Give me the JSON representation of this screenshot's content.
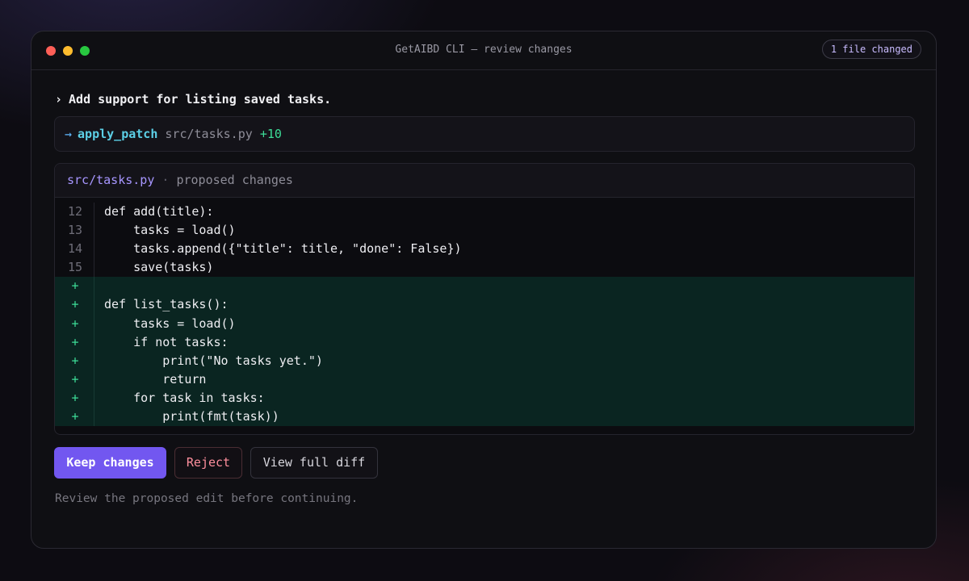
{
  "window": {
    "title": "GetAIBD CLI — review changes",
    "badge": "1 file changed"
  },
  "prompt": {
    "caret": "›",
    "text": "Add support for listing saved tasks."
  },
  "tool_call": {
    "arrow": "→",
    "name": "apply_patch",
    "path": "src/tasks.py",
    "delta": "+10"
  },
  "diff": {
    "file": "src/tasks.py",
    "separator": "·",
    "description": "proposed changes",
    "lines": [
      {
        "gutter": "12",
        "text": "def add(title):",
        "added": false
      },
      {
        "gutter": "13",
        "text": "    tasks = load()",
        "added": false
      },
      {
        "gutter": "14",
        "text": "    tasks.append({\"title\": title, \"done\": False})",
        "added": false
      },
      {
        "gutter": "15",
        "text": "    save(tasks)",
        "added": false
      },
      {
        "gutter": "+",
        "text": "",
        "added": true
      },
      {
        "gutter": "+",
        "text": "def list_tasks():",
        "added": true
      },
      {
        "gutter": "+",
        "text": "    tasks = load()",
        "added": true
      },
      {
        "gutter": "+",
        "text": "    if not tasks:",
        "added": true
      },
      {
        "gutter": "+",
        "text": "        print(\"No tasks yet.\")",
        "added": true
      },
      {
        "gutter": "+",
        "text": "        return",
        "added": true
      },
      {
        "gutter": "+",
        "text": "    for task in tasks:",
        "added": true
      },
      {
        "gutter": "+",
        "text": "        print(fmt(task))",
        "added": true
      }
    ]
  },
  "actions": {
    "keep_label": "Keep changes",
    "reject_label": "Reject",
    "view_diff_label": "View full diff"
  },
  "hint": "Review the proposed edit before continuing.",
  "colors": {
    "accent": "#7257f0",
    "added_text": "#3ddc97",
    "added_background": "#0a2521",
    "reject": "#ff8f9d",
    "tool_name": "#5ccfe6",
    "file_name": "#a796ff"
  }
}
